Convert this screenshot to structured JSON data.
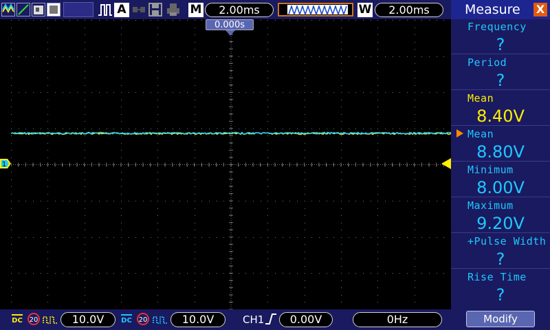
{
  "top_bar": {
    "mode_letter": "M",
    "timebase": "2.00ms",
    "window_letter": "W",
    "window_timebase": "2.00ms",
    "auto_letter": "A",
    "icons": [
      "channel1-wave-icon",
      "math-ramp-icon",
      "reference-icon",
      "pulse-icon",
      "network-icon",
      "save-disk-icon",
      "print-icon"
    ]
  },
  "screen": {
    "trigger_time": "0.000s",
    "ch1_marker": "1",
    "colors": {
      "ch1": "#ffee00",
      "ch2": "#1ec8ff",
      "grid": "#777777"
    }
  },
  "measure_panel": {
    "title": "Measure",
    "close_label": "X",
    "items": [
      {
        "label": "Frequency",
        "value": "?",
        "channel": "ch2"
      },
      {
        "label": "Period",
        "value": "?",
        "channel": "ch2"
      },
      {
        "label": "Mean",
        "value": "8.40V",
        "channel": "ch1"
      },
      {
        "label": "Mean",
        "value": "8.80V",
        "channel": "ch2",
        "selected": true
      },
      {
        "label": "Minimum",
        "value": "8.00V",
        "channel": "ch2"
      },
      {
        "label": "Maximum",
        "value": "9.20V",
        "channel": "ch2"
      },
      {
        "label": "+Pulse Width",
        "value": "?",
        "channel": "ch2"
      },
      {
        "label": "Rise Time",
        "value": "?",
        "channel": "ch2"
      }
    ],
    "modify_label": "Modify"
  },
  "bottom_bar": {
    "ch1_coupling": "DC",
    "ch1_bw": "20",
    "ch1_volts": "10.0V",
    "ch2_coupling": "DC",
    "ch2_bw": "20",
    "ch2_volts": "10.0V",
    "trigger_source": "CH1",
    "trigger_level": "0.00V",
    "frequency": "0Hz"
  }
}
